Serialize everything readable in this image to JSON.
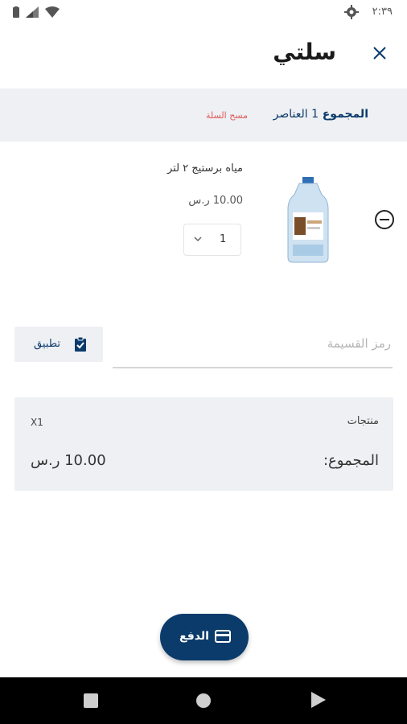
{
  "status_bar": {
    "time": "٢:٣٩",
    "icons": [
      "battery-icon",
      "signal-icon",
      "wifi-icon",
      "settings-icon"
    ]
  },
  "header": {
    "title": "سلتي",
    "close_icon": "close-icon"
  },
  "summary": {
    "total_label": "المجموع",
    "items_count": "1 العناصر",
    "clear_cart": "مسح السلة"
  },
  "cart_item": {
    "name": "مياه برستيج ٢ لتر",
    "price": "10.00 ر.س",
    "quantity": "1",
    "remove_icon": "minus-circle-icon"
  },
  "coupon": {
    "placeholder": "رمز القسيمة",
    "apply_label": "تطبيق"
  },
  "totals": {
    "products_label": "منتجات",
    "products_count": "X1",
    "total_label": "المجموع:",
    "total_value": "10.00 ر.س"
  },
  "checkout": {
    "label": "الدفع",
    "icon": "credit-card-icon"
  },
  "colors": {
    "primary": "#0b3b6b",
    "danger": "#e05a5a",
    "panel": "#eef0f3"
  }
}
